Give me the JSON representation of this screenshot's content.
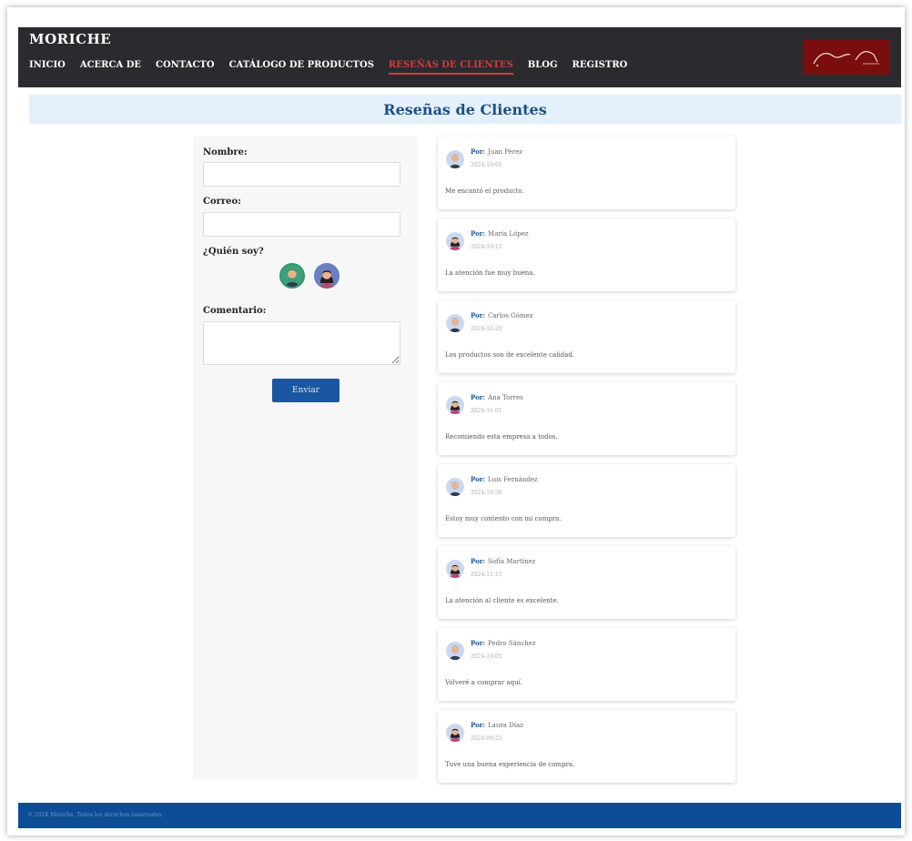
{
  "navbar": {
    "brand": "MORICHE",
    "links": [
      {
        "label": "INICIO"
      },
      {
        "label": "ACERCA DE"
      },
      {
        "label": "CONTACTO"
      },
      {
        "label": "CATÁLOGO DE PRODUCTOS"
      },
      {
        "label": "RESEÑAS DE CLIENTES",
        "active": true
      },
      {
        "label": "BLOG"
      },
      {
        "label": "REGISTRO"
      }
    ],
    "logo_icon": "moriche-logo-icon"
  },
  "page": {
    "title": "Reseñas de Clientes"
  },
  "form": {
    "name_label": "Nombre:",
    "name_value": "",
    "email_label": "Correo:",
    "email_value": "",
    "who_label": "¿Quién soy?",
    "avatar_options": [
      {
        "icon": "man-avatar-icon",
        "selected": true
      },
      {
        "icon": "woman-avatar-icon",
        "selected": false
      }
    ],
    "comment_label": "Comentario:",
    "comment_value": "",
    "submit_label": "Enviar"
  },
  "reviews": {
    "by_label": "Por:",
    "items": [
      {
        "author": "Juan Pérez",
        "date": "2024-10-01",
        "text": "Me encantó el producto.",
        "avatar": "man-avatar-icon"
      },
      {
        "author": "María López",
        "date": "2024-10-15",
        "text": "La atención fue muy buena.",
        "avatar": "woman-avatar-icon"
      },
      {
        "author": "Carlos Gómez",
        "date": "2024-10-20",
        "text": "Los productos son de excelente calidad.",
        "avatar": "man-avatar-icon"
      },
      {
        "author": "Ana Torres",
        "date": "2024-11-01",
        "text": "Recomiendo esta empresa a todos.",
        "avatar": "woman-avatar-icon"
      },
      {
        "author": "Luis Fernández",
        "date": "2024-10-30",
        "text": "Estoy muy contento con mi compra.",
        "avatar": "man-avatar-icon"
      },
      {
        "author": "Sofía Martínez",
        "date": "2024-11-15",
        "text": "La atención al cliente es excelente.",
        "avatar": "woman-avatar-icon"
      },
      {
        "author": "Pedro Sánchez",
        "date": "2024-10-05",
        "text": "Volveré a comprar aquí.",
        "avatar": "man-avatar-icon"
      },
      {
        "author": "Laura Díaz",
        "date": "2024-09-25",
        "text": "Tuve una buena experiencia de compra.",
        "avatar": "woman-avatar-icon"
      }
    ]
  },
  "footer": {
    "text": "© 2024 Moriche. Todos los derechos reservados."
  },
  "colors": {
    "nav_bg": "#2b2b2f",
    "nav_active": "#d23c3c",
    "title_bg": "#e4f0fb",
    "title_text": "#1d4f86",
    "button_bg": "#1b57a0",
    "footer_bg": "#0d4d95"
  }
}
